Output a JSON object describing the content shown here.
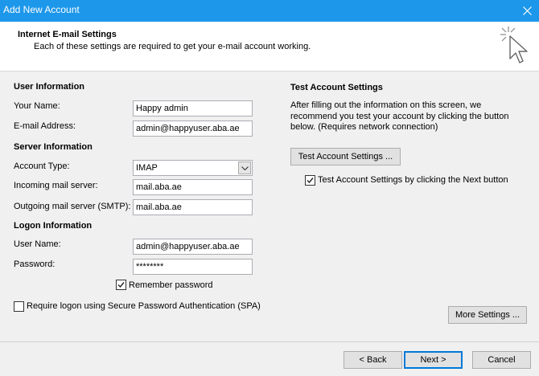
{
  "window": {
    "title": "Add New Account"
  },
  "header": {
    "title": "Internet E-mail Settings",
    "subtitle": "Each of these settings are required to get your e-mail account working."
  },
  "user_info": {
    "heading": "User Information",
    "name_label": "Your Name:",
    "name_value": "Happy admin",
    "email_label": "E-mail Address:",
    "email_value": "admin@happyuser.aba.ae"
  },
  "server_info": {
    "heading": "Server Information",
    "account_type_label": "Account Type:",
    "account_type_value": "IMAP",
    "incoming_label": "Incoming mail server:",
    "incoming_value": "mail.aba.ae",
    "outgoing_label": "Outgoing mail server (SMTP):",
    "outgoing_value": "mail.aba.ae"
  },
  "logon_info": {
    "heading": "Logon Information",
    "username_label": "User Name:",
    "username_value": "admin@happyuser.aba.ae",
    "password_label": "Password:",
    "password_value": "********",
    "remember_label": "Remember password",
    "remember_checked": true,
    "spa_label": "Require logon using Secure Password Authentication (SPA)",
    "spa_checked": false
  },
  "test_settings": {
    "heading": "Test Account Settings",
    "description": "After filling out the information on this screen, we recommend you test your account by clicking the button below. (Requires network connection)",
    "test_button": "Test Account Settings ...",
    "test_next_label": "Test Account Settings by clicking the Next button",
    "test_next_checked": true
  },
  "buttons": {
    "more_settings": "More Settings ...",
    "back": "< Back",
    "next": "Next >",
    "cancel": "Cancel"
  },
  "icons": {
    "close": "close-icon",
    "cursor": "cursor-click-icon",
    "dropdown": "chevron-down-icon",
    "check": "checkmark-icon"
  },
  "colors": {
    "titlebar": "#1c97ea",
    "default_button_border": "#0078d7"
  }
}
